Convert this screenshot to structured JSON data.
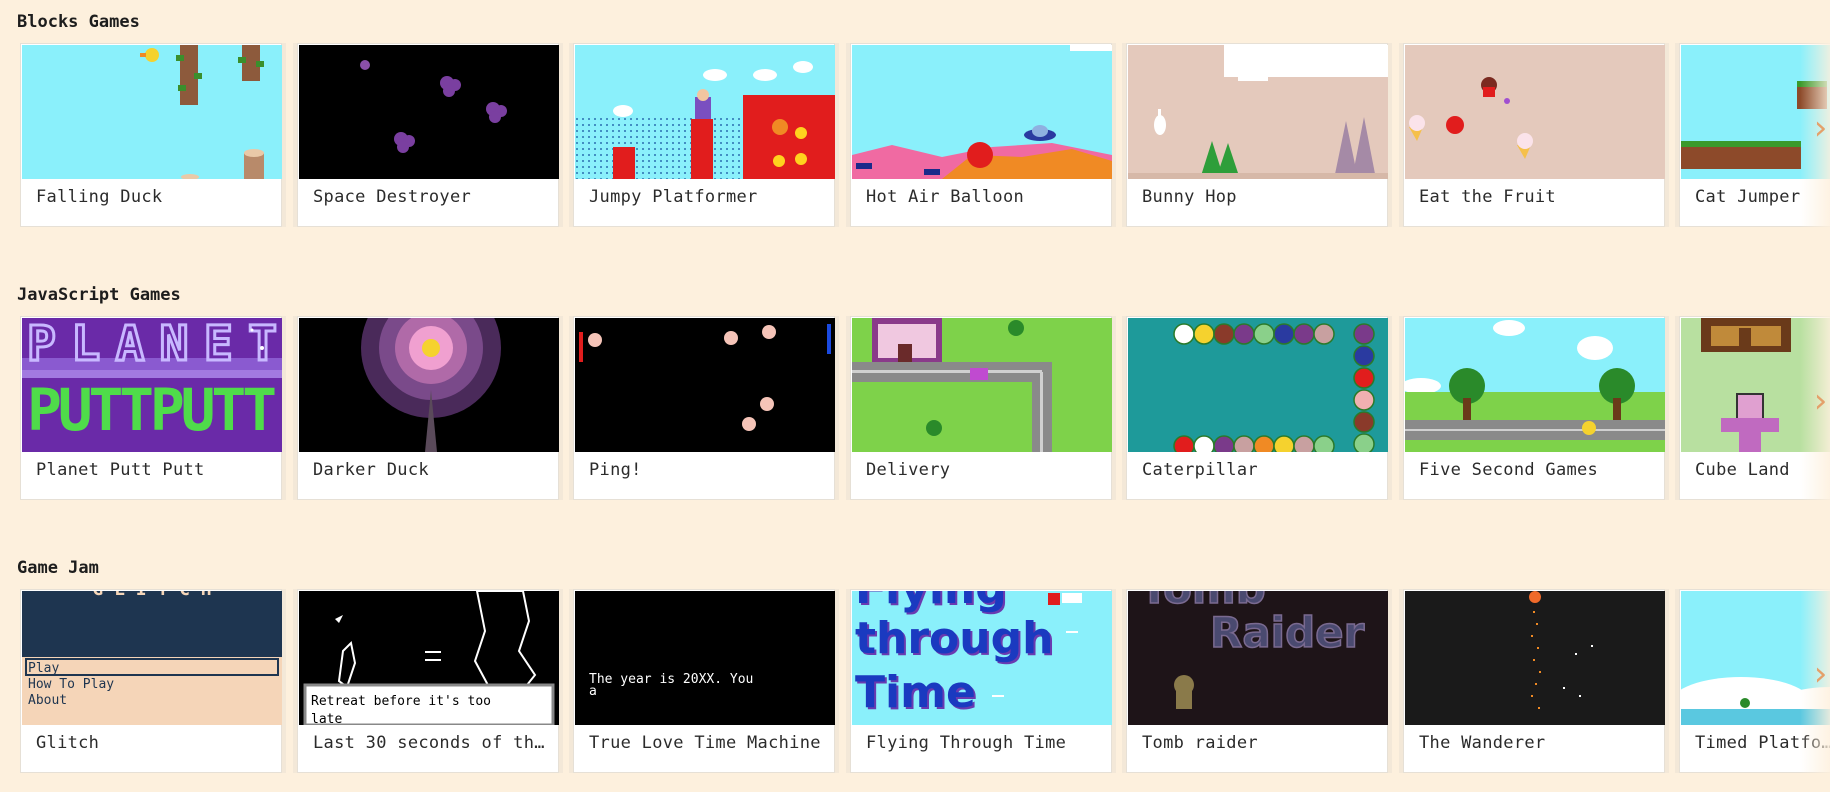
{
  "sections": [
    {
      "title": "Blocks Games",
      "games": [
        {
          "title": "Falling Duck"
        },
        {
          "title": "Space Destroyer"
        },
        {
          "title": "Jumpy Platformer"
        },
        {
          "title": "Hot Air Balloon"
        },
        {
          "title": "Bunny Hop"
        },
        {
          "title": "Eat the Fruit"
        },
        {
          "title": "Cat Jumper"
        }
      ]
    },
    {
      "title": "JavaScript Games",
      "games": [
        {
          "title": "Planet Putt Putt",
          "thumb_text": [
            "PLANET",
            "PUTTPUTT"
          ]
        },
        {
          "title": "Darker Duck"
        },
        {
          "title": "Ping!"
        },
        {
          "title": "Delivery"
        },
        {
          "title": "Caterpillar"
        },
        {
          "title": "Five Second Games"
        },
        {
          "title": "Cube Land"
        }
      ]
    },
    {
      "title": "Game Jam",
      "games": [
        {
          "title": "Glitch",
          "thumb_text": [
            "G L I T C H",
            "Play",
            "How To Play",
            "About"
          ]
        },
        {
          "title": "Last 30 seconds of th…",
          "thumb_text": [
            "Retreat before it's too",
            "late"
          ]
        },
        {
          "title": "True Love Time Machine",
          "thumb_text": [
            "The year is 20XX. You",
            "a"
          ]
        },
        {
          "title": "Flying Through Time",
          "thumb_text": [
            "Flying",
            "through",
            "Time"
          ]
        },
        {
          "title": "Tomb raider",
          "thumb_text": [
            "Tomb",
            "Raider"
          ]
        },
        {
          "title": "The Wanderer"
        },
        {
          "title": "Timed Platfo…"
        }
      ]
    }
  ],
  "icons": {
    "scroll_right": "chevron-right-icon"
  },
  "colors": {
    "page_background": "#fdf0dd",
    "card_background": "#ffffff",
    "arrow": "#e4a06a"
  }
}
